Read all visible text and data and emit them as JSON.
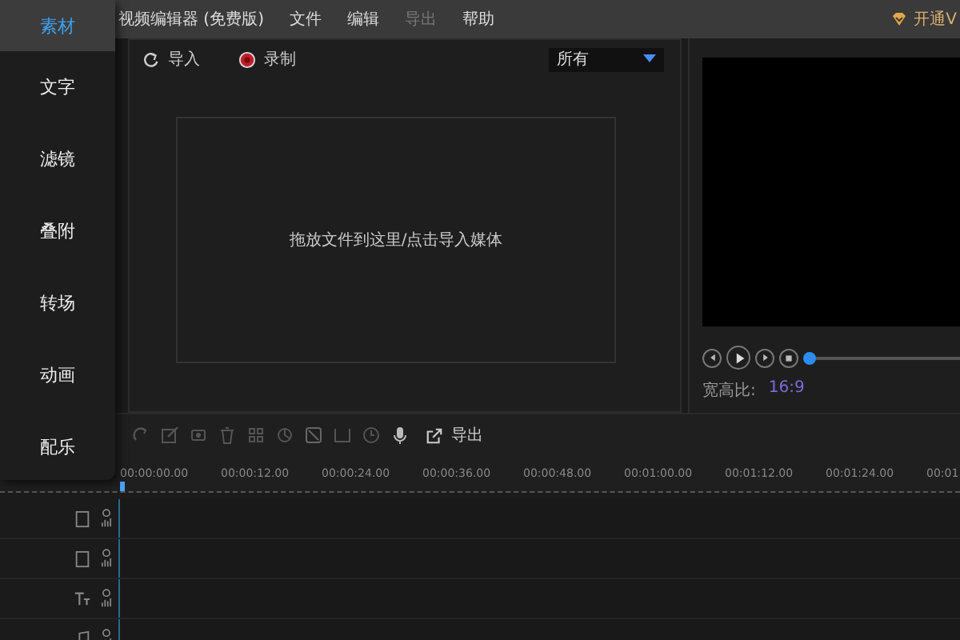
{
  "title_bar": {
    "app_title": "视频编辑器 (免费版)",
    "menus": [
      {
        "label": "文件",
        "disabled": false
      },
      {
        "label": "编辑",
        "disabled": false
      },
      {
        "label": "导出",
        "disabled": true
      },
      {
        "label": "帮助",
        "disabled": false
      }
    ],
    "vip_button": "开通V"
  },
  "sidebar": {
    "items": [
      {
        "label": "素材",
        "selected": true
      },
      {
        "label": "文字",
        "selected": false
      },
      {
        "label": "滤镜",
        "selected": false
      },
      {
        "label": "叠附",
        "selected": false
      },
      {
        "label": "转场",
        "selected": false
      },
      {
        "label": "动画",
        "selected": false
      },
      {
        "label": "配乐",
        "selected": false
      }
    ]
  },
  "media_panel": {
    "import_button": "导入",
    "record_button": "录制",
    "filter": "所有",
    "drop_hint": "拖放文件到这里/点击导入媒体"
  },
  "preview": {
    "aspect_label": "宽高比:",
    "aspect_value": "16:9",
    "progress": {
      "level": 0
    }
  },
  "toolbar": {
    "export_button": "导出"
  },
  "timeline": {
    "ticks": [
      "00:00:00.00",
      "00:00:12.00",
      "00:00:24.00",
      "00:00:36.00",
      "00:00:48.00",
      "00:01:00.00",
      "00:01:12.00",
      "00:01:24.00",
      "00:01"
    ],
    "tracks": [
      {
        "kind": "video"
      },
      {
        "kind": "video"
      },
      {
        "kind": "text"
      },
      {
        "kind": "audio"
      }
    ]
  }
}
